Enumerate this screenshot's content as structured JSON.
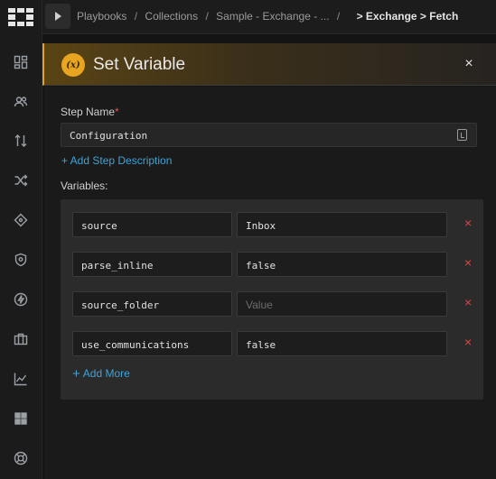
{
  "topbar": {
    "breadcrumbs": [
      "Playbooks",
      "Collections",
      "Sample - Exchange - ..."
    ],
    "trail_separator": "/",
    "current": "> Exchange > Fetch"
  },
  "panel": {
    "title": "Set Variable",
    "badge": "(x)",
    "close_symbol": "×"
  },
  "form": {
    "step_name_label": "Step Name",
    "required_marker": "*",
    "step_name_value": "Configuration",
    "add_description": "+ Add Step Description",
    "variables_label": "Variables:",
    "variables": [
      {
        "key": "source",
        "value": "Inbox",
        "placeholder": ""
      },
      {
        "key": "parse_inline",
        "value": "false",
        "placeholder": ""
      },
      {
        "key": "source_folder",
        "value": "",
        "placeholder": "Value"
      },
      {
        "key": "use_communications",
        "value": "false",
        "placeholder": ""
      }
    ],
    "remove_symbol": "×",
    "add_more": "Add More"
  },
  "rail_icons": [
    "dashboard-icon",
    "users-icon",
    "sort-icon",
    "shuffle-icon",
    "crosshair-icon",
    "shield-icon",
    "bolt-icon",
    "briefcase-icon",
    "chart-icon",
    "apps-icon",
    "support-icon"
  ],
  "colors": {
    "accent": "#e8a520",
    "link": "#3fa3d8",
    "danger": "#e04545"
  }
}
